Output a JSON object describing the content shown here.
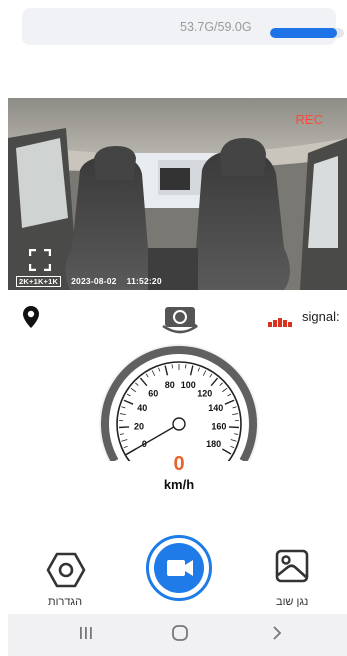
{
  "storage": {
    "text": "53.7G/59.0G",
    "used_fraction": 0.91,
    "bar_color": "#1e73e8"
  },
  "camera": {
    "rec_label": "REC",
    "resolution_badge": "2K+1K+1K",
    "date": "2023-08-02",
    "time": "11:52:20"
  },
  "status": {
    "signal_label": "signal:",
    "signal_color": "#d9321f"
  },
  "speedometer": {
    "value": "0",
    "unit": "km/h",
    "value_color": "#e8632d",
    "ticks": [
      "0",
      "20",
      "40",
      "60",
      "80",
      "100",
      "120",
      "140",
      "160",
      "180"
    ],
    "max": 180
  },
  "actions": {
    "settings_label": "הגדרות",
    "playback_label": "נגן שוב",
    "record_color": "#1e7be8"
  },
  "icons": [
    "location-pin-icon",
    "switch-camera-icon",
    "signal-bars-icon",
    "settings-hexagon-icon",
    "video-camera-icon",
    "gallery-icon",
    "expand-icon",
    "recent-apps-icon",
    "home-icon",
    "back-icon"
  ]
}
